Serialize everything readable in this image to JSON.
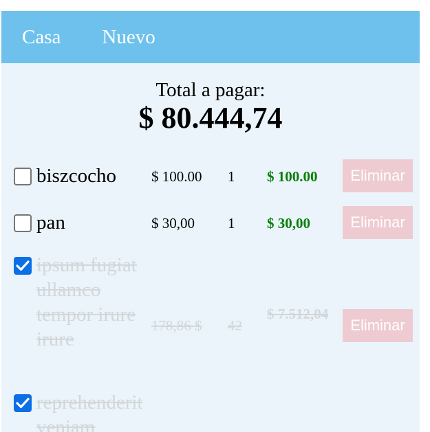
{
  "nav": {
    "home_label": "Casa",
    "new_label": "Nuevo"
  },
  "summary": {
    "label": "Total a pagar:",
    "value": "$ 80.444,74"
  },
  "items": [
    {
      "name": "biszcocho",
      "price": "$ 100.00",
      "quantity": "1",
      "subtotal": "$ 100.00",
      "checked": false,
      "delete_label": "Eliminar"
    },
    {
      "name": "pan",
      "price": "$ 30,00",
      "quantity": "1",
      "subtotal": "$ 30,00",
      "checked": false,
      "delete_label": "Eliminar"
    },
    {
      "name": "ipsum fugiat ullamco tempor irure irure",
      "price": "178,86 $",
      "quantity": "42",
      "subtotal": "$ 7.512,04",
      "checked": true,
      "delete_label": "Eliminar"
    },
    {
      "name": "reprehenderit veniam",
      "checked": true
    }
  ],
  "colors": {
    "nav": "#6ec1ec",
    "panel": "#eaf4fa",
    "subtotal": "#0a7d0a",
    "delete_button": "#eecbd1",
    "checkbox_checked": "#0b6fe6"
  }
}
